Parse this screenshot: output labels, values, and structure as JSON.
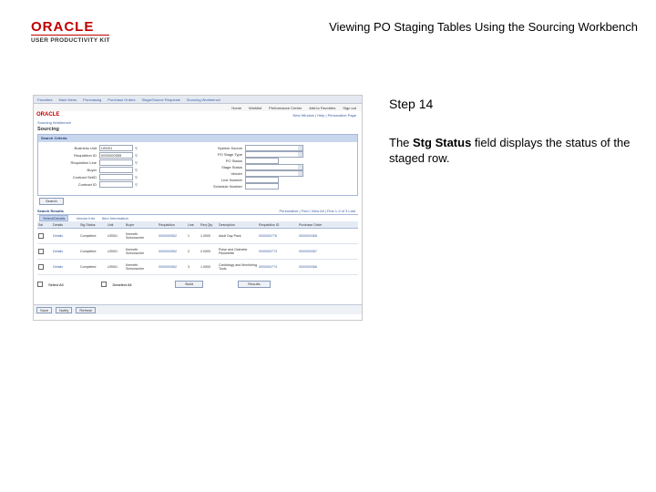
{
  "logo": {
    "brand": "ORACLE",
    "tagline": "USER PRODUCTIVITY KIT"
  },
  "doc_title": "Viewing PO Staging Tables Using the Sourcing Workbench",
  "step": {
    "title": "Step 14",
    "text_pre": "The ",
    "text_bold": "Stg Status",
    "text_post": " field displays the status of the staged row."
  },
  "screenshot": {
    "topnav": [
      "Favorites",
      "Main Menu",
      "Purchasing",
      "Purchase Orders",
      "Stage/Source Requests",
      "Sourcing Workbench"
    ],
    "ribbon": [
      "Home",
      "Worklist",
      "Performance Center",
      "Add to Favorites",
      "Sign out"
    ],
    "brand": "ORACLE",
    "header_links": "New Window | Help | Personalize Page",
    "breadcrumb": "Sourcing Workbench",
    "page_title": "Sourcing",
    "criteria_title": "Search Criteria",
    "criteria_left": [
      {
        "label": "Business Unit",
        "value": "US001"
      },
      {
        "label": "Requisition ID",
        "value": "0000000555"
      },
      {
        "label": "Requisition Line",
        "value": ""
      },
      {
        "label": "Buyer",
        "value": ""
      },
      {
        "label": "Contract SetID",
        "value": ""
      },
      {
        "label": "Contract ID",
        "value": ""
      }
    ],
    "criteria_right": [
      {
        "label": "System Source",
        "value": ""
      },
      {
        "label": "PO Stage Type",
        "value": ""
      },
      {
        "label": "PO Status",
        "value": ""
      },
      {
        "label": "Stage Status",
        "value": ""
      },
      {
        "label": "Vendor",
        "value": ""
      },
      {
        "label": "Line Number",
        "value": ""
      },
      {
        "label": "Schedule Number",
        "value": ""
      }
    ],
    "search_button": "Search",
    "results_title": "Search Results",
    "results_nav": "Personalize | Find | View All | First 1-3 of 3 Last",
    "tabs": [
      "Select/Details",
      "Vendor Info",
      "Item Information"
    ],
    "columns": [
      "Sel",
      "Details",
      "Stg Status",
      "Unit",
      "Buyer",
      "Requisition",
      "Line",
      "Req Qty",
      "Description",
      "Requisition ID",
      "Purchase Order"
    ],
    "rows": [
      {
        "details": "Details",
        "status": "Completed",
        "unit": "US001",
        "buyer": "Kenneth Schumacher",
        "req": "0000000552",
        "line": "1",
        "qty": "1.0000",
        "desc": "Adult Day Pack",
        "reqid": "0000000776",
        "po": "0000000368"
      },
      {
        "details": "Details",
        "status": "Completed",
        "unit": "US001",
        "buyer": "Kenneth Schumacher",
        "req": "0000000552",
        "line": "2",
        "qty": "2.0000",
        "desc": "Pulse and Oximeter Packetette",
        "reqid": "0000000773",
        "po": "0000000367"
      },
      {
        "details": "Details",
        "status": "Completed",
        "unit": "US001",
        "buyer": "Kenneth Schumacher",
        "req": "0000000552",
        "line": "3",
        "qty": "1.0000",
        "desc": "Cardiology and Monitoring Tools",
        "reqid": "0000000774",
        "po": "0000000366"
      }
    ],
    "select_all": "Select All",
    "deselect_all": "Deselect All",
    "build_button": "Build",
    "results_button": "Results",
    "bottom_buttons": [
      "Save",
      "Notify",
      "Refresh"
    ]
  }
}
